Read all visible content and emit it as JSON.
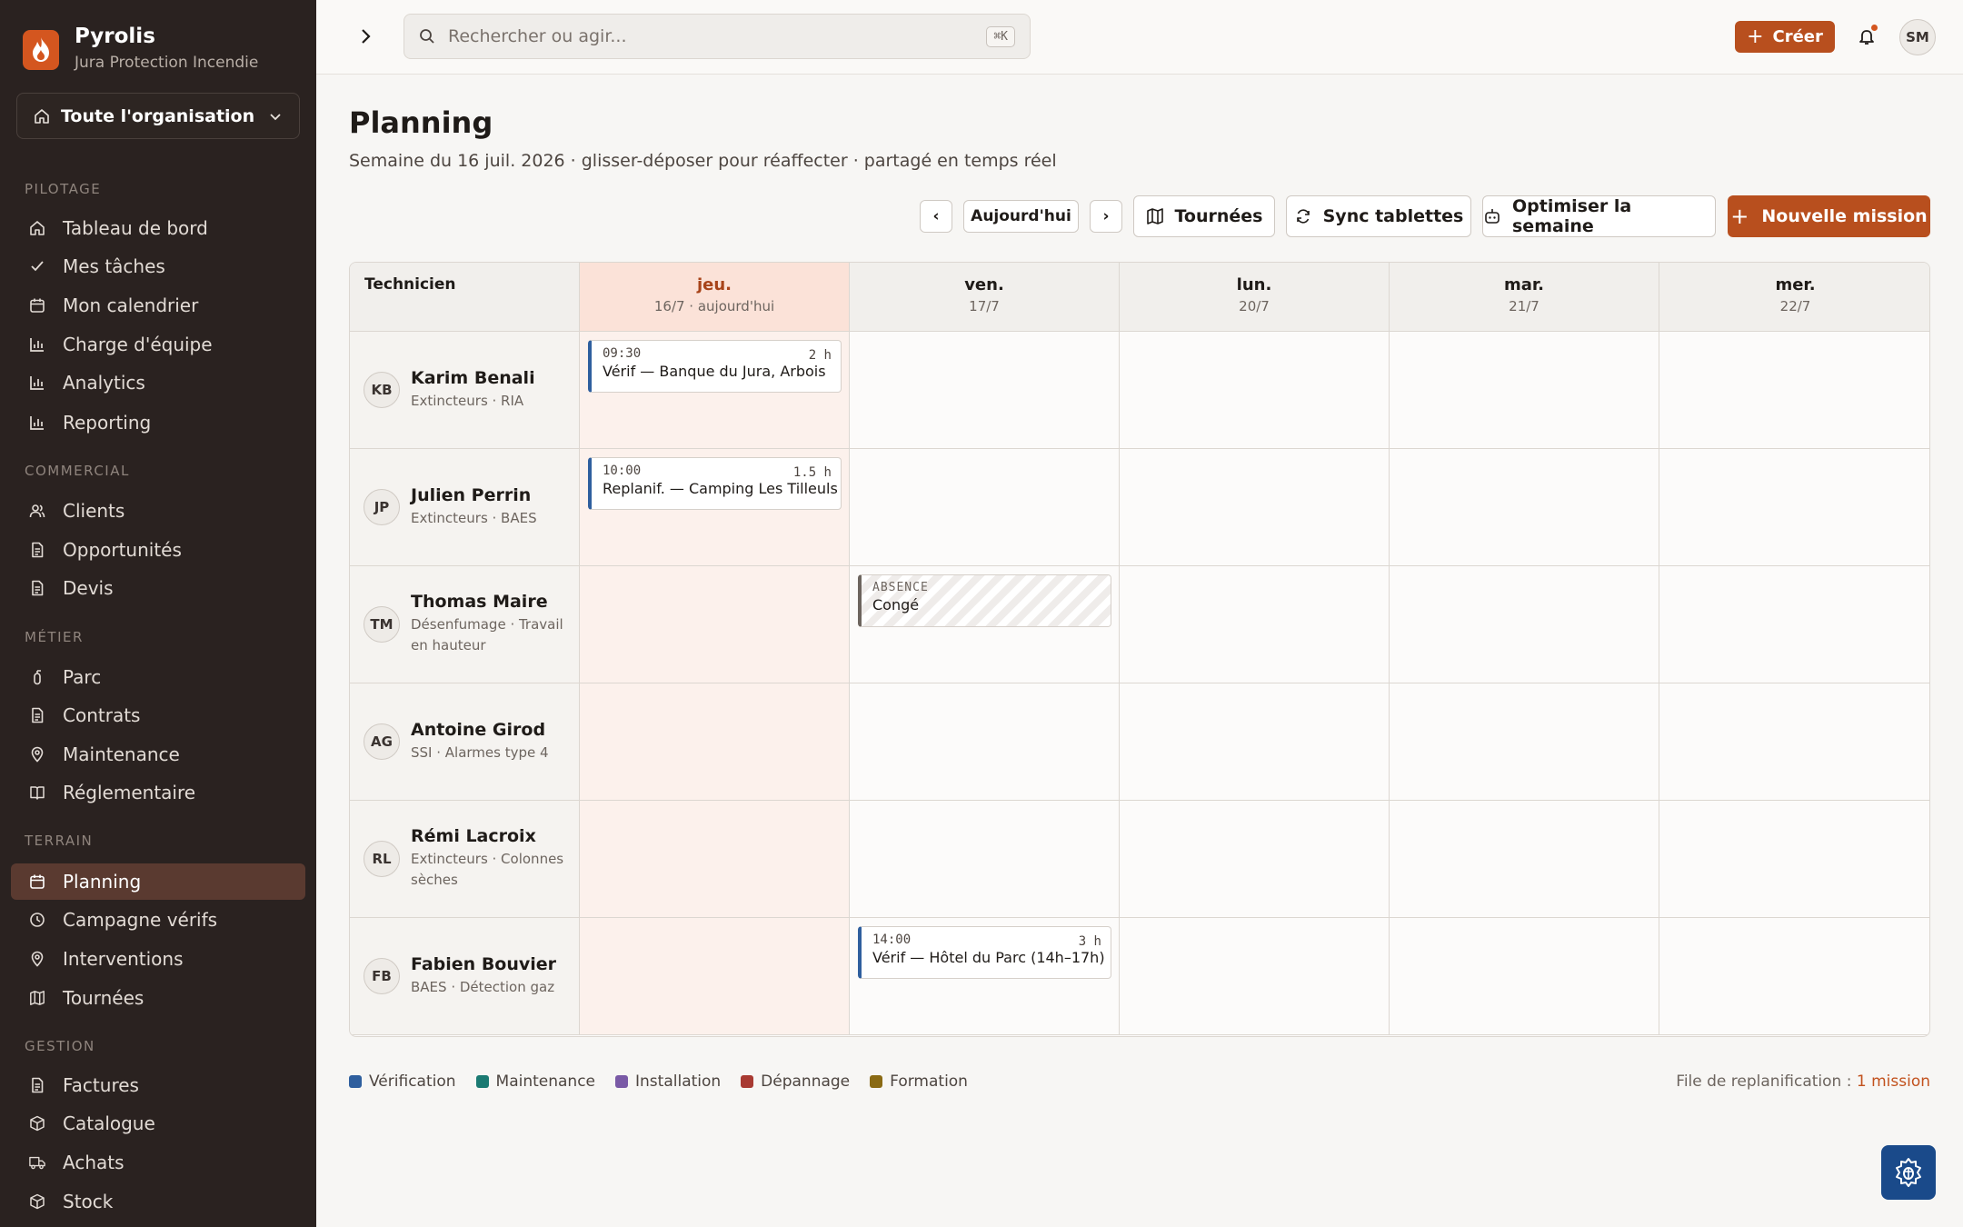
{
  "brand": {
    "name": "Pyrolis",
    "subtitle": "Jura Protection Incendie"
  },
  "org_selector": {
    "label": "Toute l'organisation"
  },
  "sidebar": {
    "sections": [
      {
        "title": "PILOTAGE",
        "items": [
          {
            "label": "Tableau de bord",
            "icon": "home-icon"
          },
          {
            "label": "Mes tâches",
            "icon": "check-icon"
          },
          {
            "label": "Mon calendrier",
            "icon": "calendar-icon"
          },
          {
            "label": "Charge d'équipe",
            "icon": "bar-chart-icon"
          },
          {
            "label": "Analytics",
            "icon": "bar-chart-icon"
          },
          {
            "label": "Reporting",
            "icon": "bar-chart-icon"
          }
        ]
      },
      {
        "title": "COMMERCIAL",
        "items": [
          {
            "label": "Clients",
            "icon": "users-icon"
          },
          {
            "label": "Opportunités",
            "icon": "document-icon"
          },
          {
            "label": "Devis",
            "icon": "document-icon"
          }
        ]
      },
      {
        "title": "MÉTIER",
        "items": [
          {
            "label": "Parc",
            "icon": "extinguisher-icon"
          },
          {
            "label": "Contrats",
            "icon": "document-icon"
          },
          {
            "label": "Maintenance",
            "icon": "pin-icon"
          },
          {
            "label": "Réglementaire",
            "icon": "book-icon"
          }
        ]
      },
      {
        "title": "TERRAIN",
        "items": [
          {
            "label": "Planning",
            "icon": "calendar-icon",
            "active": true
          },
          {
            "label": "Campagne vérifs",
            "icon": "clock-icon"
          },
          {
            "label": "Interventions",
            "icon": "pin-icon"
          },
          {
            "label": "Tournées",
            "icon": "map-icon"
          }
        ]
      },
      {
        "title": "GESTION",
        "items": [
          {
            "label": "Factures",
            "icon": "document-icon"
          },
          {
            "label": "Catalogue",
            "icon": "box-icon"
          },
          {
            "label": "Achats",
            "icon": "truck-icon"
          },
          {
            "label": "Stock",
            "icon": "box-icon"
          }
        ]
      }
    ]
  },
  "topbar": {
    "search_placeholder": "Rechercher ou agir...",
    "shortcut": "⌘K",
    "create_label": "Créer",
    "user_initials": "SM"
  },
  "page": {
    "title": "Planning",
    "subtitle": "Semaine du 16 juil. 2026 · glisser-déposer pour réaffecter · partagé en temps réel"
  },
  "toolbar": {
    "prev": "‹",
    "today": "Aujourd'hui",
    "next": "›",
    "tournees": "Tournées",
    "sync": "Sync tablettes",
    "optimize": "Optimiser la semaine",
    "new_mission": "Nouvelle mission"
  },
  "grid": {
    "tech_header": "Technicien",
    "days": [
      {
        "day": "jeu.",
        "date": "16/7 · aujourd'hui",
        "today": true
      },
      {
        "day": "ven.",
        "date": "17/7"
      },
      {
        "day": "lun.",
        "date": "20/7"
      },
      {
        "day": "mar.",
        "date": "21/7"
      },
      {
        "day": "mer.",
        "date": "22/7"
      }
    ],
    "technicians": [
      {
        "initials": "KB",
        "name": "Karim Benali",
        "skills": "Extincteurs · RIA"
      },
      {
        "initials": "JP",
        "name": "Julien Perrin",
        "skills": "Extincteurs · BAES"
      },
      {
        "initials": "TM",
        "name": "Thomas Maire",
        "skills": "Désenfumage · Travail en hauteur"
      },
      {
        "initials": "AG",
        "name": "Antoine Girod",
        "skills": "SSI · Alarmes type 4"
      },
      {
        "initials": "RL",
        "name": "Rémi Lacroix",
        "skills": "Extincteurs · Colonnes sèches"
      },
      {
        "initials": "FB",
        "name": "Fabien Bouvier",
        "skills": "BAES · Détection gaz"
      }
    ],
    "missions": [
      {
        "tech": 0,
        "day": 0,
        "time": "09:30",
        "duration": "2 h",
        "title": "Vérif — Banque du Jura, Arbois",
        "type": "verification"
      },
      {
        "tech": 1,
        "day": 0,
        "time": "10:00",
        "duration": "1.5 h",
        "title": "Replanif. — Camping Les Tilleuls",
        "type": "verification"
      },
      {
        "tech": 2,
        "day": 1,
        "time": "ABSENCE",
        "duration": "",
        "title": "Congé",
        "type": "absence"
      },
      {
        "tech": 5,
        "day": 1,
        "time": "14:00",
        "duration": "3 h",
        "title": "Vérif — Hôtel du Parc (14h–17h)",
        "type": "verification"
      }
    ]
  },
  "legend": [
    {
      "label": "Vérification",
      "color": "#2f5f9e"
    },
    {
      "label": "Maintenance",
      "color": "#1b7a72"
    },
    {
      "label": "Installation",
      "color": "#7a5aa6"
    },
    {
      "label": "Dépannage",
      "color": "#a83a32"
    },
    {
      "label": "Formation",
      "color": "#8a6a14"
    }
  ],
  "replan": {
    "label": "File de replanification : ",
    "link": "1 mission"
  },
  "colors": {
    "accent": "#b84f1e",
    "sidebar_bg": "#2a2220",
    "today_bg": "#fcf1ec"
  }
}
